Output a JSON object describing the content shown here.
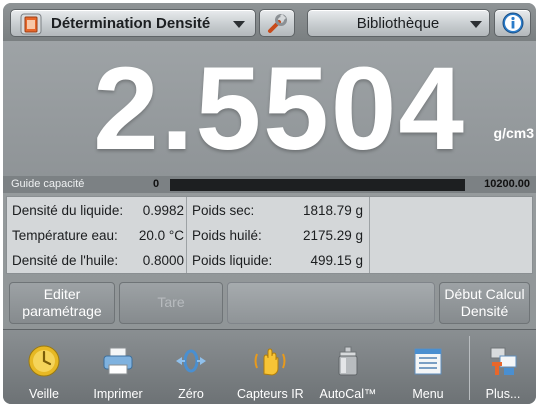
{
  "header": {
    "mode_label": "Détermination Densité",
    "library_label": "Bibliothèque"
  },
  "readout": {
    "value": "2.5504",
    "unit": "g/cm3"
  },
  "capacity_guide": {
    "label": "Guide capacité",
    "min": "0",
    "max": "10200.00"
  },
  "info": {
    "liquid_density": {
      "label": "Densité du liquide:",
      "value": "0.9982"
    },
    "water_temp": {
      "label": "Température eau:",
      "value": "20.0 °C"
    },
    "oil_density": {
      "label": "Densité de l'huile:",
      "value": "0.8000"
    },
    "dry_weight": {
      "label": "Poids sec:",
      "value": "1818.79 g"
    },
    "oiled_weight": {
      "label": "Poids huilé:",
      "value": "2175.29 g"
    },
    "liquid_weight": {
      "label": "Poids liquide:",
      "value": "499.15 g"
    }
  },
  "actions": {
    "edit_line1": "Editer",
    "edit_line2": "paramétrage",
    "tare": "Tare",
    "start_line1": "Début Calcul",
    "start_line2": "Densité"
  },
  "toolbar": [
    {
      "label": "Veille",
      "icon": "standby-icon"
    },
    {
      "label": "Imprimer",
      "icon": "printer-icon"
    },
    {
      "label": "Zéro",
      "icon": "zero-icon"
    },
    {
      "label": "Capteurs IR",
      "icon": "ir-sensor-hand-icon"
    },
    {
      "label": "AutoCal™",
      "icon": "calibration-weight-icon"
    },
    {
      "label": "Menu",
      "icon": "menu-icon"
    },
    {
      "label": "Plus...",
      "icon": "more-icon"
    }
  ],
  "colors": {
    "accent_orange": "#e8672a",
    "info_blue": "#2b7cc9",
    "capacity_bar": "#1d1f21"
  }
}
